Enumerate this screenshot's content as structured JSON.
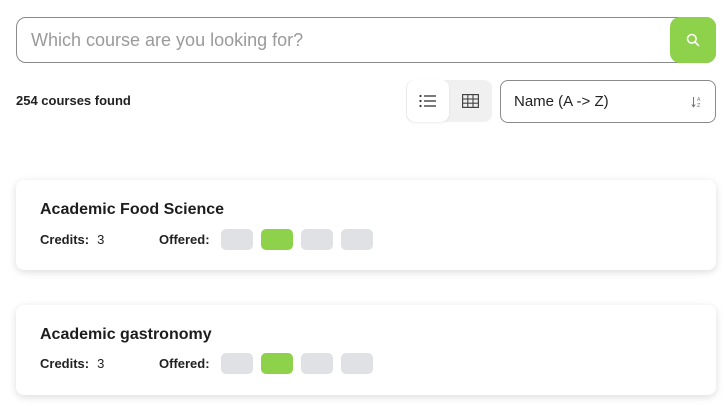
{
  "search": {
    "placeholder": "Which course are you looking for?",
    "value": "",
    "button_icon": "search-icon",
    "accent": "#8ed14a"
  },
  "results": {
    "count_label": "254 courses found"
  },
  "view_toggle": {
    "options": [
      {
        "name": "list",
        "icon": "list-icon",
        "selected": true
      },
      {
        "name": "grid",
        "icon": "grid-icon",
        "selected": false
      }
    ]
  },
  "sort": {
    "selected": "Name (A -> Z)",
    "icon": "sort-az-icon"
  },
  "courses": [
    {
      "title": "Academic Food Science",
      "credits_label": "Credits:",
      "credits": "3",
      "offered_label": "Offered:",
      "offered": [
        false,
        true,
        false,
        false
      ]
    },
    {
      "title": "Academic gastronomy",
      "credits_label": "Credits:",
      "credits": "3",
      "offered_label": "Offered:",
      "offered": [
        false,
        true,
        false,
        false
      ]
    }
  ],
  "colors": {
    "offered_on": "#8ed14a",
    "offered_off": "#dfe1e5"
  }
}
